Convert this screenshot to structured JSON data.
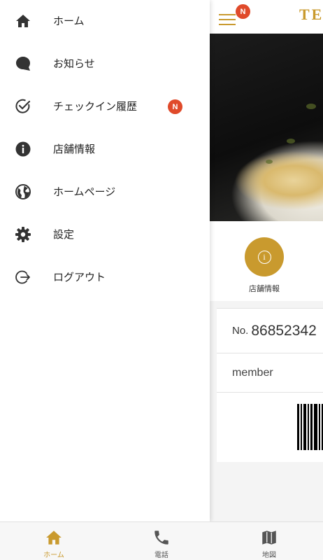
{
  "brand": {
    "logo_text": "TE",
    "accent_color": "#c99a2e",
    "badge_color": "#e04a2a"
  },
  "header": {
    "menu_icon": "hamburger-icon",
    "badge": "N"
  },
  "quick_actions": [
    {
      "icon": "info-icon",
      "glyph": "i",
      "label": "店舗情報"
    }
  ],
  "member_card": {
    "no_label": "No.",
    "number": "86852342",
    "member_label": "member"
  },
  "drawer": {
    "items": [
      {
        "icon": "home-icon",
        "label": "ホーム"
      },
      {
        "icon": "chat-bubble-icon",
        "label": "お知らせ"
      },
      {
        "icon": "check-circle-icon",
        "label": "チェックイン履歴",
        "badge": "N"
      },
      {
        "icon": "info-icon",
        "label": "店舗情報"
      },
      {
        "icon": "globe-icon",
        "label": "ホームページ"
      },
      {
        "icon": "gear-icon",
        "label": "設定"
      },
      {
        "icon": "logout-icon",
        "label": "ログアウト"
      }
    ]
  },
  "tabbar": {
    "tabs": [
      {
        "icon": "home-icon",
        "label": "ホーム",
        "active": true
      },
      {
        "icon": "phone-icon",
        "label": "電話",
        "active": false
      },
      {
        "icon": "map-icon",
        "label": "地図",
        "active": false
      }
    ]
  }
}
